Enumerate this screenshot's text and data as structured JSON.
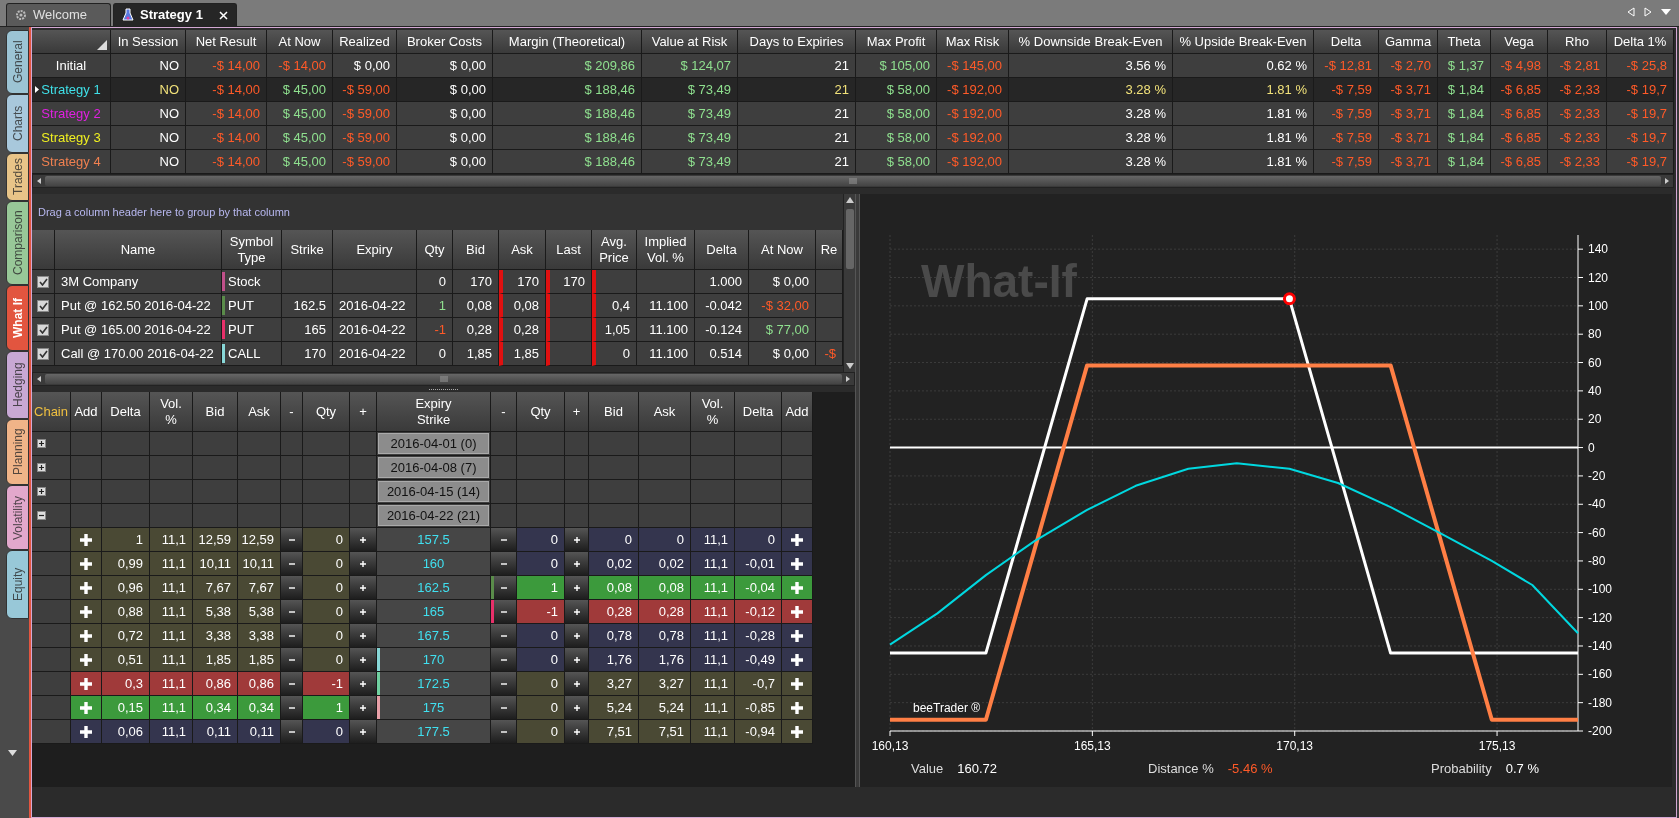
{
  "tabs": [
    {
      "label": "Welcome",
      "selected": false,
      "closable": false
    },
    {
      "label": "Strategy 1",
      "selected": true,
      "closable": true
    }
  ],
  "side_tabs": [
    {
      "label": "General",
      "color": "#9cc4d4",
      "selected": false
    },
    {
      "label": "Charts",
      "color": "#a8c8dc",
      "selected": false
    },
    {
      "label": "Trades",
      "color": "#e8c488",
      "selected": false
    },
    {
      "label": "Comparison",
      "color": "#98c898",
      "selected": false
    },
    {
      "label": "What If",
      "color": "#e2553f",
      "selected": true
    },
    {
      "label": "Hedging",
      "color": "#c8a8d4",
      "selected": false
    },
    {
      "label": "Planning",
      "color": "#f0b488",
      "selected": false
    },
    {
      "label": "Volatility",
      "color": "#e2a8cc",
      "selected": false
    },
    {
      "label": "Equity",
      "color": "#98c8d8",
      "selected": false
    }
  ],
  "summary": {
    "columns": [
      "In Session",
      "Net Result",
      "At Now",
      "Realized",
      "Broker Costs",
      "Margin (Theoretical)",
      "Value at Risk",
      "Days to Expiries",
      "Max Profit",
      "Max Risk",
      "% Downside Break-Even",
      "% Upside Break-Even",
      "Delta",
      "Gamma",
      "Theta",
      "Vega",
      "Rho",
      "Delta 1%"
    ],
    "rows": [
      {
        "name": "Initial",
        "color": "#ffffff",
        "selected": false,
        "cells": [
          {
            "text": "NO"
          },
          {
            "text": "-$ 14,00",
            "color": "#ff5a28"
          },
          {
            "text": "-$ 14,00",
            "color": "#ff5a28"
          },
          {
            "text": "$ 0,00"
          },
          {
            "text": "$ 0,00"
          },
          {
            "text": "$ 209,86",
            "color": "#8fe08f"
          },
          {
            "text": "$ 124,07",
            "color": "#8fe08f"
          },
          {
            "text": "21"
          },
          {
            "text": "$ 105,00",
            "color": "#8fe08f"
          },
          {
            "text": "-$ 145,00",
            "color": "#ff5a28"
          },
          {
            "text": "3.56 %"
          },
          {
            "text": "0.62 %"
          },
          {
            "text": "-$ 12,81",
            "color": "#ff5a28"
          },
          {
            "text": "-$ 2,70",
            "color": "#ff5a28"
          },
          {
            "text": "$ 1,37",
            "color": "#8fe08f"
          },
          {
            "text": "-$ 4,98",
            "color": "#ff5a28"
          },
          {
            "text": "-$ 2,81",
            "color": "#ff5a28"
          },
          {
            "text": "-$ 25,8",
            "color": "#ff5a28"
          }
        ]
      },
      {
        "name": "Strategy 1",
        "color": "#3fe0e8",
        "selected": true,
        "cells": [
          {
            "text": "NO",
            "color": "#f2e27a"
          },
          {
            "text": "-$ 14,00",
            "color": "#ff5a28"
          },
          {
            "text": "$ 45,00",
            "color": "#8fe08f"
          },
          {
            "text": "-$ 59,00",
            "color": "#ff5a28"
          },
          {
            "text": "$ 0,00"
          },
          {
            "text": "$ 188,46",
            "color": "#8fe08f"
          },
          {
            "text": "$ 73,49",
            "color": "#8fe08f"
          },
          {
            "text": "21",
            "color": "#f2e27a"
          },
          {
            "text": "$ 58,00",
            "color": "#8fe08f"
          },
          {
            "text": "-$ 192,00",
            "color": "#ff5a28"
          },
          {
            "text": "3.28 %",
            "color": "#f2e27a"
          },
          {
            "text": "1.81 %",
            "color": "#f2e27a"
          },
          {
            "text": "-$ 7,59",
            "color": "#ff5a28"
          },
          {
            "text": "-$ 3,71",
            "color": "#ff5a28"
          },
          {
            "text": "$ 1,84",
            "color": "#8fe08f"
          },
          {
            "text": "-$ 6,85",
            "color": "#ff5a28"
          },
          {
            "text": "-$ 2,33",
            "color": "#ff5a28"
          },
          {
            "text": "-$ 19,7",
            "color": "#ff5a28"
          }
        ]
      },
      {
        "name": "Strategy 2",
        "color": "#e020e0",
        "selected": false,
        "cells": [
          {
            "text": "NO"
          },
          {
            "text": "-$ 14,00",
            "color": "#ff5a28"
          },
          {
            "text": "$ 45,00",
            "color": "#8fe08f"
          },
          {
            "text": "-$ 59,00",
            "color": "#ff5a28"
          },
          {
            "text": "$ 0,00"
          },
          {
            "text": "$ 188,46",
            "color": "#8fe08f"
          },
          {
            "text": "$ 73,49",
            "color": "#8fe08f"
          },
          {
            "text": "21"
          },
          {
            "text": "$ 58,00",
            "color": "#8fe08f"
          },
          {
            "text": "-$ 192,00",
            "color": "#ff5a28"
          },
          {
            "text": "3.28 %"
          },
          {
            "text": "1.81 %"
          },
          {
            "text": "-$ 7,59",
            "color": "#ff5a28"
          },
          {
            "text": "-$ 3,71",
            "color": "#ff5a28"
          },
          {
            "text": "$ 1,84",
            "color": "#8fe08f"
          },
          {
            "text": "-$ 6,85",
            "color": "#ff5a28"
          },
          {
            "text": "-$ 2,33",
            "color": "#ff5a28"
          },
          {
            "text": "-$ 19,7",
            "color": "#ff5a28"
          }
        ]
      },
      {
        "name": "Strategy 3",
        "color": "#f0f020",
        "selected": false,
        "cells": [
          {
            "text": "NO"
          },
          {
            "text": "-$ 14,00",
            "color": "#ff5a28"
          },
          {
            "text": "$ 45,00",
            "color": "#8fe08f"
          },
          {
            "text": "-$ 59,00",
            "color": "#ff5a28"
          },
          {
            "text": "$ 0,00"
          },
          {
            "text": "$ 188,46",
            "color": "#8fe08f"
          },
          {
            "text": "$ 73,49",
            "color": "#8fe08f"
          },
          {
            "text": "21"
          },
          {
            "text": "$ 58,00",
            "color": "#8fe08f"
          },
          {
            "text": "-$ 192,00",
            "color": "#ff5a28"
          },
          {
            "text": "3.28 %"
          },
          {
            "text": "1.81 %"
          },
          {
            "text": "-$ 7,59",
            "color": "#ff5a28"
          },
          {
            "text": "-$ 3,71",
            "color": "#ff5a28"
          },
          {
            "text": "$ 1,84",
            "color": "#8fe08f"
          },
          {
            "text": "-$ 6,85",
            "color": "#ff5a28"
          },
          {
            "text": "-$ 2,33",
            "color": "#ff5a28"
          },
          {
            "text": "-$ 19,7",
            "color": "#ff5a28"
          }
        ]
      },
      {
        "name": "Strategy 4",
        "color": "#f08050",
        "selected": false,
        "cells": [
          {
            "text": "NO"
          },
          {
            "text": "-$ 14,00",
            "color": "#ff5a28"
          },
          {
            "text": "$ 45,00",
            "color": "#8fe08f"
          },
          {
            "text": "-$ 59,00",
            "color": "#ff5a28"
          },
          {
            "text": "$ 0,00"
          },
          {
            "text": "$ 188,46",
            "color": "#8fe08f"
          },
          {
            "text": "$ 73,49",
            "color": "#8fe08f"
          },
          {
            "text": "21"
          },
          {
            "text": "$ 58,00",
            "color": "#8fe08f"
          },
          {
            "text": "-$ 192,00",
            "color": "#ff5a28"
          },
          {
            "text": "3.28 %"
          },
          {
            "text": "1.81 %"
          },
          {
            "text": "-$ 7,59",
            "color": "#ff5a28"
          },
          {
            "text": "-$ 3,71",
            "color": "#ff5a28"
          },
          {
            "text": "$ 1,84",
            "color": "#8fe08f"
          },
          {
            "text": "-$ 6,85",
            "color": "#ff5a28"
          },
          {
            "text": "-$ 2,33",
            "color": "#ff5a28"
          },
          {
            "text": "-$ 19,7",
            "color": "#ff5a28"
          }
        ]
      }
    ]
  },
  "positions": {
    "group_hint": "Drag a column header here to group by that column",
    "columns": [
      "Name",
      "Symbol\nType",
      "Strike",
      "Expiry",
      "Qty",
      "Bid",
      "Ask",
      "Last",
      "Avg.\nPrice",
      "Implied\nVol. %",
      "Delta",
      "At Now",
      "Re"
    ],
    "rows": [
      {
        "checked": true,
        "color": "#c0508a",
        "cells": [
          {
            "text": "3M Company"
          },
          {
            "text": "Stock"
          },
          null,
          null,
          {
            "text": "0"
          },
          {
            "text": "170"
          },
          {
            "text": "170"
          },
          {
            "text": "170"
          },
          null,
          null,
          {
            "text": "1.000"
          },
          {
            "text": "$ 0,00"
          },
          null
        ]
      },
      {
        "checked": true,
        "color": "#5a8c4a",
        "cells": [
          {
            "text": "Put @ 162.50 2016-04-22"
          },
          {
            "text": "PUT"
          },
          {
            "text": "162.5"
          },
          {
            "text": "2016-04-22"
          },
          {
            "text": "1",
            "color": "#8fe08f"
          },
          {
            "text": "0,08"
          },
          {
            "text": "0,08"
          },
          null,
          {
            "text": "0,4"
          },
          {
            "text": "11.100"
          },
          {
            "text": "-0.042"
          },
          {
            "text": "-$ 32,00",
            "color": "#ff5a28"
          },
          null
        ]
      },
      {
        "checked": true,
        "color": "#e8306a",
        "cells": [
          {
            "text": "Put @ 165.00 2016-04-22"
          },
          {
            "text": "PUT"
          },
          {
            "text": "165"
          },
          {
            "text": "2016-04-22"
          },
          {
            "text": "-1",
            "color": "#ff5a28"
          },
          {
            "text": "0,28"
          },
          {
            "text": "0,28"
          },
          null,
          {
            "text": "1,05"
          },
          {
            "text": "11.100"
          },
          {
            "text": "-0.124"
          },
          {
            "text": "$ 77,00",
            "color": "#8fe08f"
          },
          null
        ]
      },
      {
        "checked": true,
        "color": "#88d8d8",
        "cells": [
          {
            "text": "Call @ 170.00 2016-04-22"
          },
          {
            "text": "CALL"
          },
          {
            "text": "170"
          },
          {
            "text": "2016-04-22"
          },
          {
            "text": "0"
          },
          {
            "text": "1,85"
          },
          {
            "text": "1,85"
          },
          null,
          {
            "text": "0"
          },
          {
            "text": "11.100"
          },
          {
            "text": "0.514"
          },
          {
            "text": "$ 0,00"
          },
          {
            "text": "-$",
            "color": "#ff5a28"
          }
        ]
      }
    ]
  },
  "chain": {
    "columns": [
      "Chain",
      "Add",
      "Delta",
      "Vol.\n%",
      "Bid",
      "Ask",
      "-",
      "Qty",
      "+",
      "Expiry\nStrike",
      "-",
      "Qty",
      "+",
      "Bid",
      "Ask",
      "Vol.\n%",
      "Delta",
      "Add"
    ],
    "expiries": [
      {
        "label": "2016-04-01 (0)",
        "expanded": false
      },
      {
        "label": "2016-04-08 (7)",
        "expanded": false
      },
      {
        "label": "2016-04-15 (14)",
        "expanded": false
      },
      {
        "label": "2016-04-22 (21)",
        "expanded": true,
        "children": [
          {
            "strike": "157.5",
            "call": {
              "color": "#4a4934",
              "cells": [
                "1",
                "11,1",
                "12,59",
                "12,59",
                "0"
              ]
            },
            "put": {
              "color": "#34354e",
              "cells": [
                "0",
                "0",
                "0",
                "11,1",
                "0"
              ]
            }
          },
          {
            "strike": "160",
            "call": {
              "color": "#4a4934",
              "cells": [
                "0,99",
                "11,1",
                "10,11",
                "10,11",
                "0"
              ]
            },
            "put": {
              "color": "#34354e",
              "cells": [
                "0",
                "0,02",
                "0,02",
                "11,1",
                "-0,01"
              ]
            }
          },
          {
            "strike": "162.5",
            "call": {
              "color": "#4a4934",
              "cells": [
                "0,96",
                "11,1",
                "7,67",
                "7,67",
                "0"
              ]
            },
            "put": {
              "color": "#3c9a3c",
              "cells": [
                "1",
                "0,08",
                "0,08",
                "11,1",
                "-0,04"
              ]
            },
            "put_marker": {
              "color": "#5a8c4a"
            }
          },
          {
            "strike": "165",
            "call": {
              "color": "#4a4934",
              "cells": [
                "0,88",
                "11,1",
                "5,38",
                "5,38",
                "0"
              ]
            },
            "put": {
              "color": "#a03a3a",
              "cells": [
                "-1",
                "0,28",
                "0,28",
                "11,1",
                "-0,12"
              ]
            },
            "put_marker": {
              "color": "#e8306a"
            }
          },
          {
            "strike": "167.5",
            "call": {
              "color": "#4a4934",
              "cells": [
                "0,72",
                "11,1",
                "3,38",
                "3,38",
                "0"
              ]
            },
            "put": {
              "color": "#34354e",
              "cells": [
                "0",
                "0,78",
                "0,78",
                "11,1",
                "-0,28"
              ]
            }
          },
          {
            "strike": "170",
            "call": {
              "color": "#4a4934",
              "cells": [
                "0,51",
                "11,1",
                "1,85",
                "1,85",
                "0"
              ]
            },
            "put": {
              "color": "#34354e",
              "cells": [
                "0",
                "1,76",
                "1,76",
                "11,1",
                "-0,49"
              ]
            },
            "call_marker": {
              "color": "#88d8d8"
            }
          },
          {
            "strike": "172.5",
            "call": {
              "color": "#a03a3a",
              "cells": [
                "0,3",
                "11,1",
                "0,86",
                "0,86",
                "-1"
              ]
            },
            "put": {
              "color": "#4a4934",
              "cells": [
                "0",
                "3,27",
                "3,27",
                "11,1",
                "-0,7"
              ]
            },
            "call_marker": {
              "color": "#70d0a0"
            }
          },
          {
            "strike": "175",
            "call": {
              "color": "#3c9a3c",
              "cells": [
                "0,15",
                "11,1",
                "0,34",
                "0,34",
                "1"
              ]
            },
            "put": {
              "color": "#4a4934",
              "cells": [
                "0",
                "5,24",
                "5,24",
                "11,1",
                "-0,85"
              ]
            },
            "call_marker": {
              "color": "#e8a0a8"
            }
          },
          {
            "strike": "177.5",
            "call": {
              "color": "#34354e",
              "cells": [
                "0,06",
                "11,1",
                "0,11",
                "0,11",
                "0"
              ]
            },
            "put": {
              "color": "#4a4934",
              "cells": [
                "0",
                "7,51",
                "7,51",
                "11,1",
                "-0,94"
              ]
            }
          }
        ]
      }
    ]
  },
  "chart_panel": {
    "chart_data": {
      "type": "line",
      "title": "What-If",
      "grid": true,
      "x": [
        160.13,
        161.3,
        162.5,
        163.7,
        165,
        166.2,
        167.5,
        168.7,
        170,
        171.2,
        172.5,
        173.7,
        175,
        176,
        177.13
      ],
      "series": [
        {
          "color": "#ffffff",
          "values": [
            -145,
            -145,
            -145,
            -25,
            105,
            105,
            105,
            105,
            105,
            -15,
            -145,
            -145,
            -145,
            -145,
            -145
          ]
        },
        {
          "color": "#ff7f45",
          "values": [
            -192,
            -192,
            -192,
            -72,
            58,
            58,
            58,
            58,
            58,
            58,
            58,
            -62,
            -192,
            -192,
            -192
          ]
        },
        {
          "color": "#00d8e0",
          "values": [
            -139,
            -117,
            -90,
            -66,
            -44,
            -27,
            -15,
            -11,
            -15,
            -25,
            -42,
            -60,
            -80,
            -97,
            -131
          ]
        }
      ],
      "xlim": [
        160.13,
        177.13
      ],
      "ylim": [
        -200,
        150
      ],
      "xticks": [
        {
          "value": 160.13,
          "label": "160,13"
        },
        {
          "value": 165.13,
          "label": "165,13"
        },
        {
          "value": 170.13,
          "label": "170,13"
        },
        {
          "value": 175.13,
          "label": "175,13"
        }
      ],
      "yticks": [
        140,
        120,
        100,
        80,
        60,
        40,
        20,
        0,
        -20,
        -40,
        -60,
        -80,
        -100,
        -120,
        -140,
        -160,
        -180,
        -200
      ]
    },
    "brand": "beeTrader ®",
    "status": [
      {
        "label": "Value",
        "value": "160.72"
      },
      {
        "label": "Distance %",
        "value": "-5.46 %",
        "color": "#ff5a28"
      },
      {
        "label": "Probability",
        "value": "0.7 %"
      }
    ]
  }
}
